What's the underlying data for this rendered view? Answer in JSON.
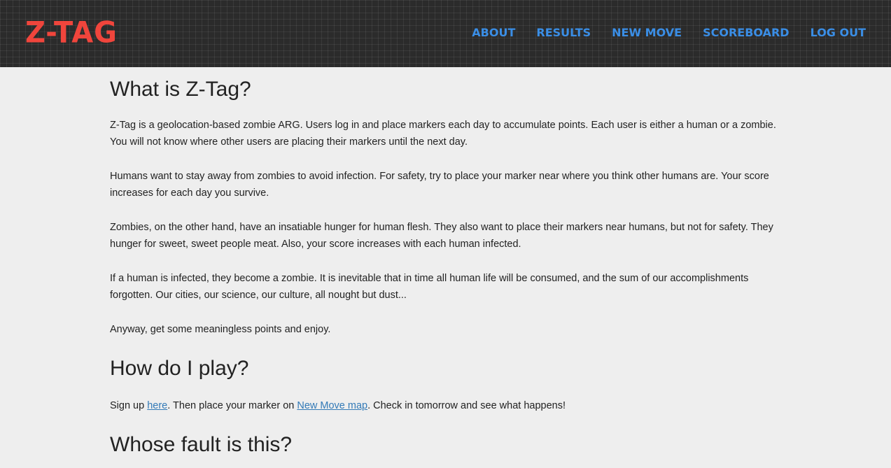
{
  "navbar": {
    "brand": "Z-TAG",
    "links": [
      "ABOUT",
      "RESULTS",
      "NEW MOVE",
      "SCOREBOARD",
      "LOG OUT"
    ]
  },
  "main": {
    "heading_what": "What is Z-Tag?",
    "paragraphs": [
      "Z-Tag is a geolocation-based zombie ARG. Users log in and place markers each day to accumulate points. Each user is either a human or a zombie. You will not know where other users are placing their markers until the next day.",
      "Humans want to stay away from zombies to avoid infection. For safety, try to place your marker near where you think other humans are. Your score increases for each day you survive.",
      "Zombies, on the other hand, have an insatiable hunger for human flesh. They also want to place their markers near humans, but not for safety. They hunger for sweet, sweet people meat. Also, your score increases with each human infected.",
      "If a human is infected, they become a zombie. It is inevitable that in time all human life will be consumed, and the sum of our accomplishments forgotten. Our cities, our science, our culture, all nought but dust...",
      "Anyway, get some meaningless points and enjoy."
    ],
    "heading_how": "How do I play?",
    "how": {
      "prefix": "Sign up ",
      "link1": "here",
      "middle": ". Then place your marker on ",
      "link2": "New Move map",
      "suffix": ". Check in tomorrow and see what happens!"
    },
    "heading_whose": "Whose fault is this?"
  },
  "colors": {
    "brand": "#f0453c",
    "nav_link": "#3a8ee6",
    "page_bg": "#eeeeee",
    "link": "#337ab7"
  }
}
